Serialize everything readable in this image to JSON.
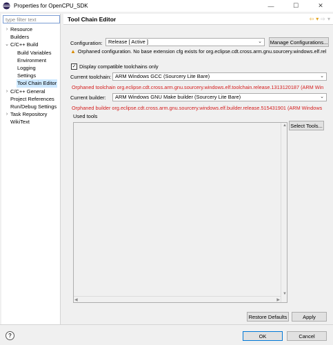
{
  "window": {
    "title": "Properties for OpenCPU_SDK",
    "minimize_glyph": "—",
    "maximize_glyph": "☐",
    "close_glyph": "✕"
  },
  "sidebar": {
    "filter_placeholder": "type filter text",
    "items": [
      {
        "label": "Resource",
        "chevron": "›",
        "level": 0
      },
      {
        "label": "Builders",
        "chevron": "",
        "level": 0
      },
      {
        "label": "C/C++ Build",
        "chevron": "⌄",
        "level": 0
      },
      {
        "label": "Build Variables",
        "chevron": "",
        "level": 1
      },
      {
        "label": "Environment",
        "chevron": "",
        "level": 1
      },
      {
        "label": "Logging",
        "chevron": "",
        "level": 1
      },
      {
        "label": "Settings",
        "chevron": "",
        "level": 1
      },
      {
        "label": "Tool Chain Editor",
        "chevron": "",
        "level": 1,
        "selected": true
      },
      {
        "label": "C/C++ General",
        "chevron": "›",
        "level": 0
      },
      {
        "label": "Project References",
        "chevron": "",
        "level": 0
      },
      {
        "label": "Run/Debug Settings",
        "chevron": "",
        "level": 0
      },
      {
        "label": "Task Repository",
        "chevron": "›",
        "level": 0
      },
      {
        "label": "WikiText",
        "chevron": "",
        "level": 0
      }
    ]
  },
  "page": {
    "title": "Tool Chain Editor",
    "nav_back_glyph": "⇦",
    "nav_forward_glyph": "⇨",
    "nav_menu_glyph": "▾",
    "configuration_label": "Configuration:",
    "configuration_value": "Release  [ Active ]",
    "manage_button": "Manage Configurations...",
    "orphan_config_warning": "Orphaned configuration. No base extension cfg exists for org.eclipse.cdt.cross.arm.gnu.sourcery.windows.elf.rel",
    "display_compatible_label": "Display compatible toolchains only",
    "display_compatible_checked": true,
    "current_toolchain_label": "Current toolchain:",
    "current_toolchain_value": "ARM Windows GCC (Sourcery Lite Bare)",
    "orphan_toolchain_warning": "Orphaned toolchain org.eclipse.cdt.cross.arm.gnu.sourcery.windows.elf.toolchain.release.1313120187 (ARM Win",
    "current_builder_label": "Current builder:",
    "current_builder_value": "ARM Windows GNU Make builder (Sourcery Lite Bare)",
    "orphan_builder_warning": "Orphaned builder org.eclipse.cdt.cross.arm.gnu.sourcery.windows.elf.builder.release.515431901 (ARM Windows",
    "used_tools_label": "Used tools",
    "select_tools_button": "Select Tools...",
    "restore_defaults_button": "Restore Defaults",
    "apply_button": "Apply"
  },
  "footer": {
    "help_glyph": "?",
    "ok_button": "OK",
    "cancel_button": "Cancel"
  },
  "colors": {
    "warning_red": "#d41c1c",
    "selection": "#cce8ff",
    "accent": "#0078d7"
  }
}
